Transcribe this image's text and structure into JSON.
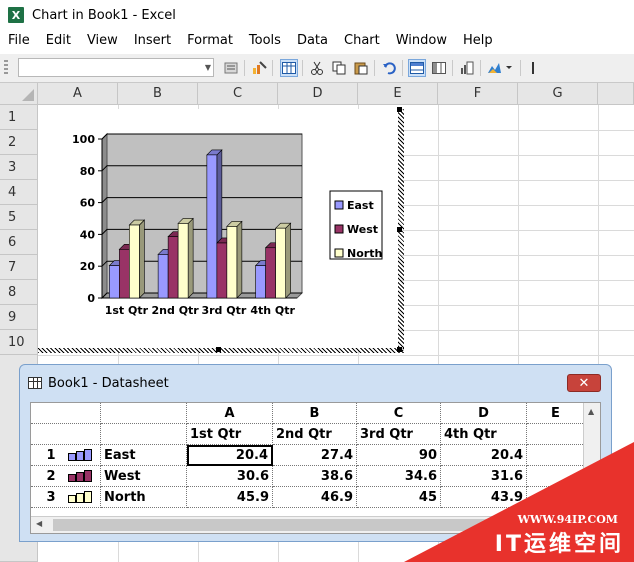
{
  "window": {
    "title": "Chart in Book1 - Excel",
    "app_icon_glyph": "X"
  },
  "menu": [
    "File",
    "Edit",
    "View",
    "Insert",
    "Format",
    "Tools",
    "Data",
    "Chart",
    "Window",
    "Help"
  ],
  "toolbar": {
    "namebox_value": "",
    "buttons": [
      "format-icon",
      "chart-wizard-icon",
      "datasheet-icon",
      "cut-icon",
      "copy-icon",
      "paste-icon",
      "undo-icon",
      "by-row-icon",
      "by-column-icon",
      "data-table-icon",
      "chart-type-icon"
    ]
  },
  "sheet": {
    "columns": [
      "A",
      "B",
      "C",
      "D",
      "E",
      "F",
      "G"
    ],
    "rows": [
      "1",
      "2",
      "3",
      "4",
      "5",
      "6",
      "7",
      "8",
      "9",
      "10"
    ]
  },
  "chart_data": {
    "type": "bar",
    "categories": [
      "1st Qtr",
      "2nd Qtr",
      "3rd Qtr",
      "4th Qtr"
    ],
    "series": [
      {
        "name": "East",
        "values": [
          20.4,
          27.4,
          90,
          20.4
        ],
        "color": "#9999ff"
      },
      {
        "name": "West",
        "values": [
          30.6,
          38.6,
          34.6,
          31.6
        ],
        "color": "#993366"
      },
      {
        "name": "North",
        "values": [
          45.9,
          46.9,
          45,
          43.9
        ],
        "color": "#ffffcc"
      }
    ],
    "ylim": [
      0,
      100
    ],
    "yticks": [
      0,
      20,
      40,
      60,
      80,
      100
    ],
    "plot_background": "#c0c0c0",
    "legend_position": "right",
    "grid": true
  },
  "datasheet": {
    "title": "Book1 - Datasheet",
    "close_glyph": "✕",
    "col_letters": [
      "A",
      "B",
      "C",
      "D",
      "E"
    ],
    "col_headers": [
      "1st Qtr",
      "2nd Qtr",
      "3rd Qtr",
      "4th Qtr"
    ],
    "rows": [
      {
        "num": "1",
        "label": "East",
        "values": [
          "20.4",
          "27.4",
          "90",
          "20.4"
        ],
        "icon_color": "#9999ff"
      },
      {
        "num": "2",
        "label": "West",
        "values": [
          "30.6",
          "38.6",
          "34.6",
          "31.6"
        ],
        "icon_color": "#993366"
      },
      {
        "num": "3",
        "label": "North",
        "values": [
          "45.9",
          "46.9",
          "45",
          "43.9"
        ],
        "icon_color": "#ffffcc"
      }
    ]
  },
  "watermark": {
    "url": "WWW.94IP.COM",
    "text": "IT运维空间"
  }
}
